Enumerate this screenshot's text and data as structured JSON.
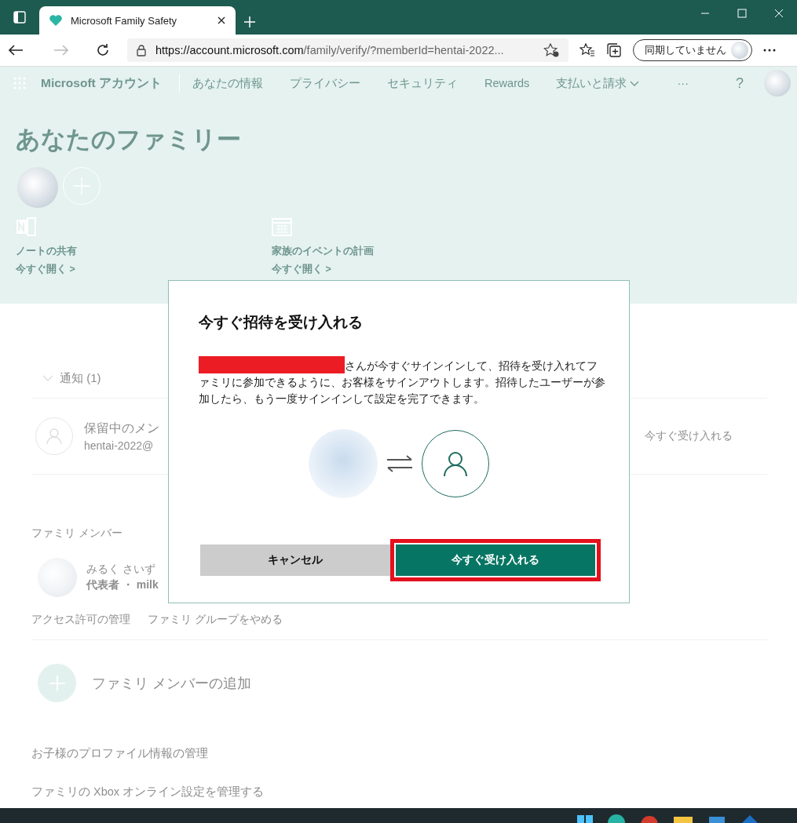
{
  "browser": {
    "tab_title": "Microsoft Family Safety",
    "url_host": "https://account.microsoft.com",
    "url_path": "/family/verify/?memberId=hentai-2022...",
    "sync_label": "同期していません"
  },
  "nav": {
    "brand": "Microsoft アカウント",
    "items": [
      {
        "label": "あなたの情報",
        "kind": "link"
      },
      {
        "label": "プライバシー",
        "kind": "link"
      },
      {
        "label": "セキュリティ",
        "kind": "link"
      },
      {
        "label": "Rewards",
        "kind": "link"
      },
      {
        "label": "支払いと請求",
        "kind": "menu"
      }
    ],
    "more": "···",
    "help": "?"
  },
  "hero": {
    "title": "あなたのファミリー",
    "features": [
      {
        "kind": "notebook",
        "label": "ノートの共有",
        "link": "今すぐ開く >"
      },
      {
        "kind": "calendar",
        "label": "家族のイベントの計画",
        "link": "今すぐ開く >"
      }
    ]
  },
  "notifications": {
    "header": "通知 (1)",
    "expanded": true,
    "pending": {
      "name": "保留中のメン",
      "email": "hentai-2022@",
      "action": "今すぐ受け入れる"
    }
  },
  "members": {
    "header": "ファミリ メンバー",
    "member": {
      "name": "みるく さいず",
      "role": "代表者 ・ milk"
    },
    "links": [
      "アクセス許可の管理",
      "ファミリ グループをやめる"
    ]
  },
  "add_member": "ファミリ メンバーの追加",
  "links": [
    "お子様のプロファイル情報の管理",
    "ファミリの Xbox オンライン設定を管理する"
  ],
  "dialog": {
    "title": "今すぐ招待を受け入れる",
    "redacted": true,
    "message": "さんが今すぐサインインして、招待を受け入れてファミリに参加できるように、お客様をサインアウトします。招待したユーザーが参加したら、もう一度サインインして設定を完了できます。",
    "buttons": [
      {
        "kind": "secondary",
        "label": "キャンセル",
        "highlighted": false
      },
      {
        "kind": "primary",
        "label": "今すぐ受け入れる",
        "highlighted": true
      }
    ]
  }
}
